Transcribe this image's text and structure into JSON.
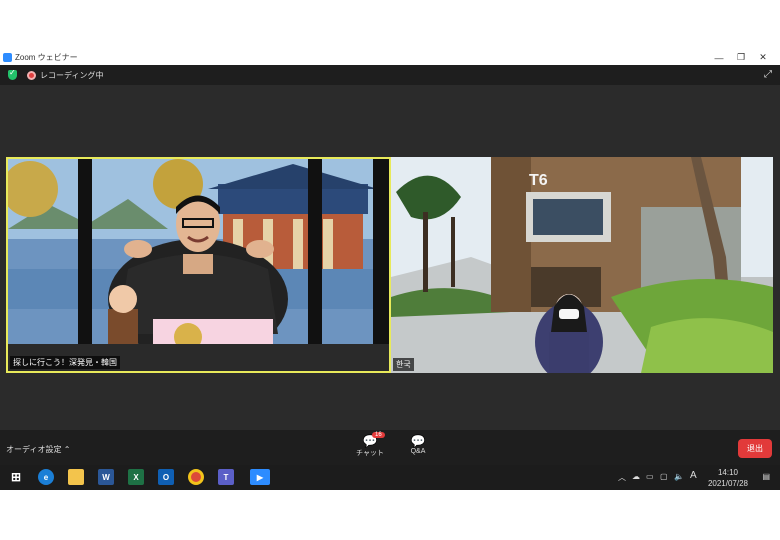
{
  "window": {
    "title": "Zoom ウェビナー"
  },
  "top": {
    "recording_label": "レコーディング中"
  },
  "videos": [
    {
      "name": "探しに行こう！深発見・韓国",
      "speaking": true
    },
    {
      "name": "한국",
      "speaking": false
    }
  ],
  "bottom": {
    "audio_label": "オーディオ設定",
    "chat_label": "チャット",
    "chat_count": "16",
    "qa_label": "Q&A",
    "leave_label": "退出"
  },
  "taskbar": {
    "time": "14:10",
    "date": "2021/07/28",
    "ime": "A",
    "apps": [
      "windows-start",
      "edge",
      "file-explorer",
      "word",
      "excel",
      "outlook",
      "chrome",
      "teams",
      "zoom"
    ]
  },
  "colors": {
    "accent": "#2d8cff",
    "speaker_border": "#e8ea5a",
    "leave": "#e23a3a",
    "badge": "#e23a3a"
  }
}
